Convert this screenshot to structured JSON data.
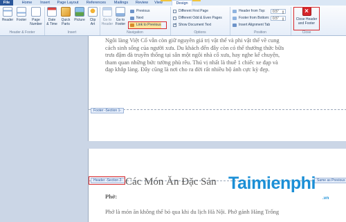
{
  "ribbon": {
    "tabs": [
      {
        "label": "File"
      },
      {
        "label": "Home"
      },
      {
        "label": "Insert"
      },
      {
        "label": "Page Layout"
      },
      {
        "label": "References"
      },
      {
        "label": "Mailings"
      },
      {
        "label": "Review"
      },
      {
        "label": "View"
      },
      {
        "label": "Design"
      }
    ],
    "groups": {
      "header_footer": {
        "label": "Header & Footer",
        "header_btn": "Header",
        "footer_btn": "Footer",
        "page_number_btn_1": "Page",
        "page_number_btn_2": "Number"
      },
      "insert": {
        "label": "Insert",
        "date_time_1": "Date",
        "date_time_2": "& Time",
        "quick_parts_1": "Quick",
        "quick_parts_2": "Parts",
        "picture": "Picture",
        "clip_art_1": "Clip",
        "clip_art_2": "Art"
      },
      "navigation": {
        "label": "Navigation",
        "go_to_header_1": "Go to",
        "go_to_header_2": "Header",
        "go_to_footer_1": "Go to",
        "go_to_footer_2": "Footer",
        "previous": "Previous",
        "next": "Next",
        "link_to_previous": "Link to Previous"
      },
      "options": {
        "label": "Options",
        "different_first_page": "Different First Page",
        "different_odd_even": "Different Odd & Even Pages",
        "show_document_text": "Show Document Text"
      },
      "position": {
        "label": "Position",
        "header_from_top": "Header from Top:",
        "header_from_top_value": "0.5\"",
        "footer_from_bottom": "Footer from Bottom:",
        "footer_from_bottom_value": "0.5\"",
        "insert_alignment_tab": "Insert Alignment Tab"
      },
      "close": {
        "label": "Close",
        "close_btn_1": "Close Header",
        "close_btn_2": "and Footer"
      }
    }
  },
  "document": {
    "page1_lines": [
      "Ngôi làng Việt Cổ vẫn còn giữ nguyên giá trị vật thể và phi vật thể về cung",
      "cách sinh sống của người xưa. Du khách đến đây còn có thể thưởng thức bữa",
      "trưa đậm đà truyền thống tại sân một ngôi nhà cổ xưa, hay nghe kể chuyện,",
      "tham quan những bức tường phù rêu. Thú vị nhất là thuê 1 chiếc xe đạp và",
      "đạp khắp làng. Đây cũng là nơi cho ra đời rất nhiều bộ ảnh cực kỳ đẹp."
    ],
    "footer_tag": "Footer -Section 1-",
    "header_tag": "Header -Section 2-",
    "same_as_previous": "Same as Previous",
    "heading": "Các Món Ăn Đặc Sản",
    "subheading": "Phở:",
    "page2_line": "Phở là món ăn không thể bỏ qua khi du lịch Hà Nội. Phở gánh Hàng Trống"
  },
  "watermark": {
    "brand": "Taimienphi",
    "tld": ".vn"
  },
  "colors": {
    "accent_red": "#d6262a",
    "file_tab": "#2b579a",
    "context_tab": "#f2c43a",
    "watermark_blue": "#1b8fd6"
  }
}
